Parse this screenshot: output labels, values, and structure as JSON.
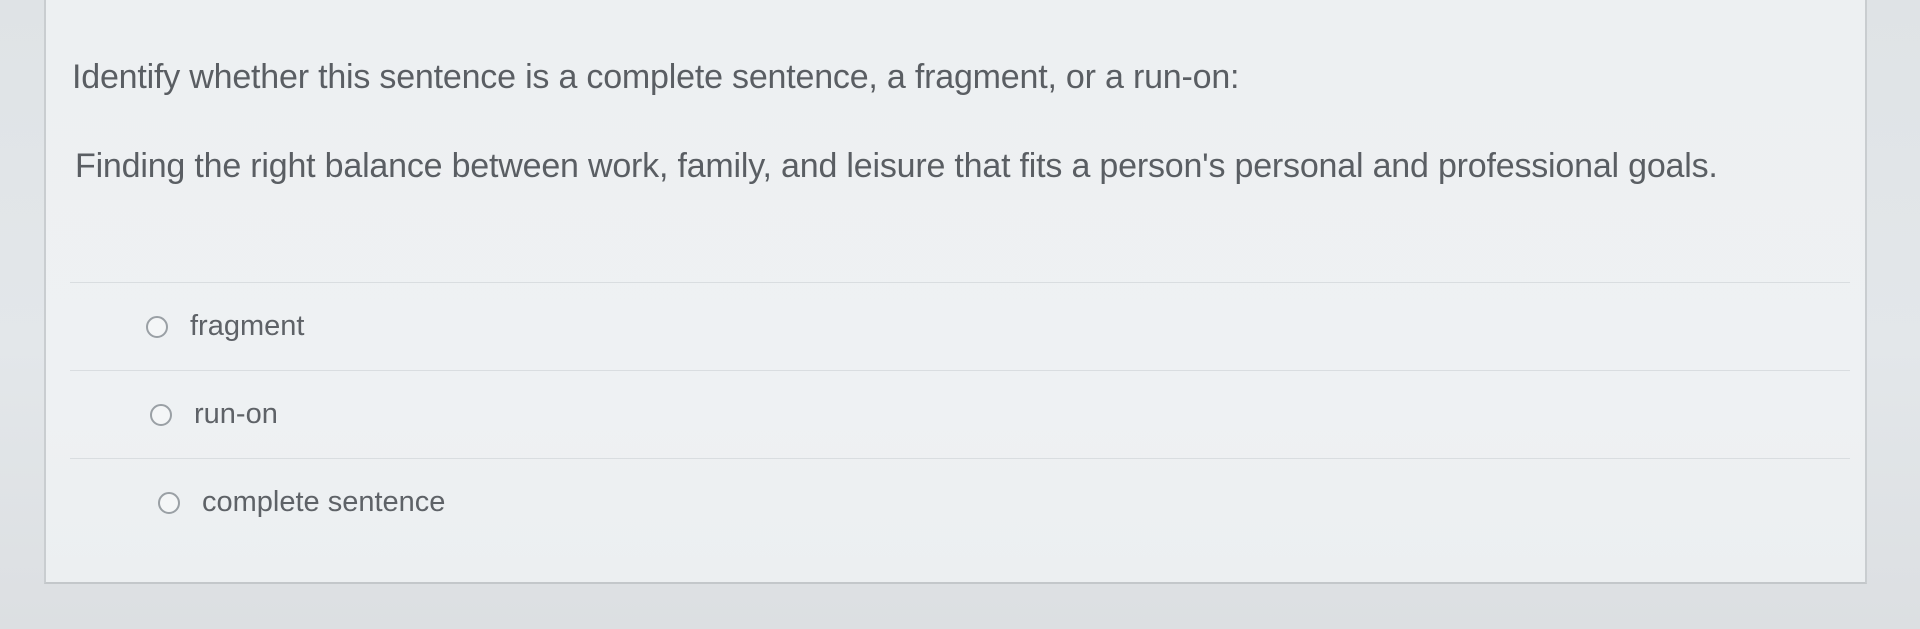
{
  "question": {
    "prompt": "Identify whether this sentence is a complete sentence, a fragment, or a run-on:",
    "sentence": "Finding the right balance between work, family, and leisure that fits a person's personal and professional goals."
  },
  "options": [
    {
      "label": "fragment",
      "selected": false
    },
    {
      "label": "run-on",
      "selected": false
    },
    {
      "label": "complete sentence",
      "selected": false
    }
  ]
}
